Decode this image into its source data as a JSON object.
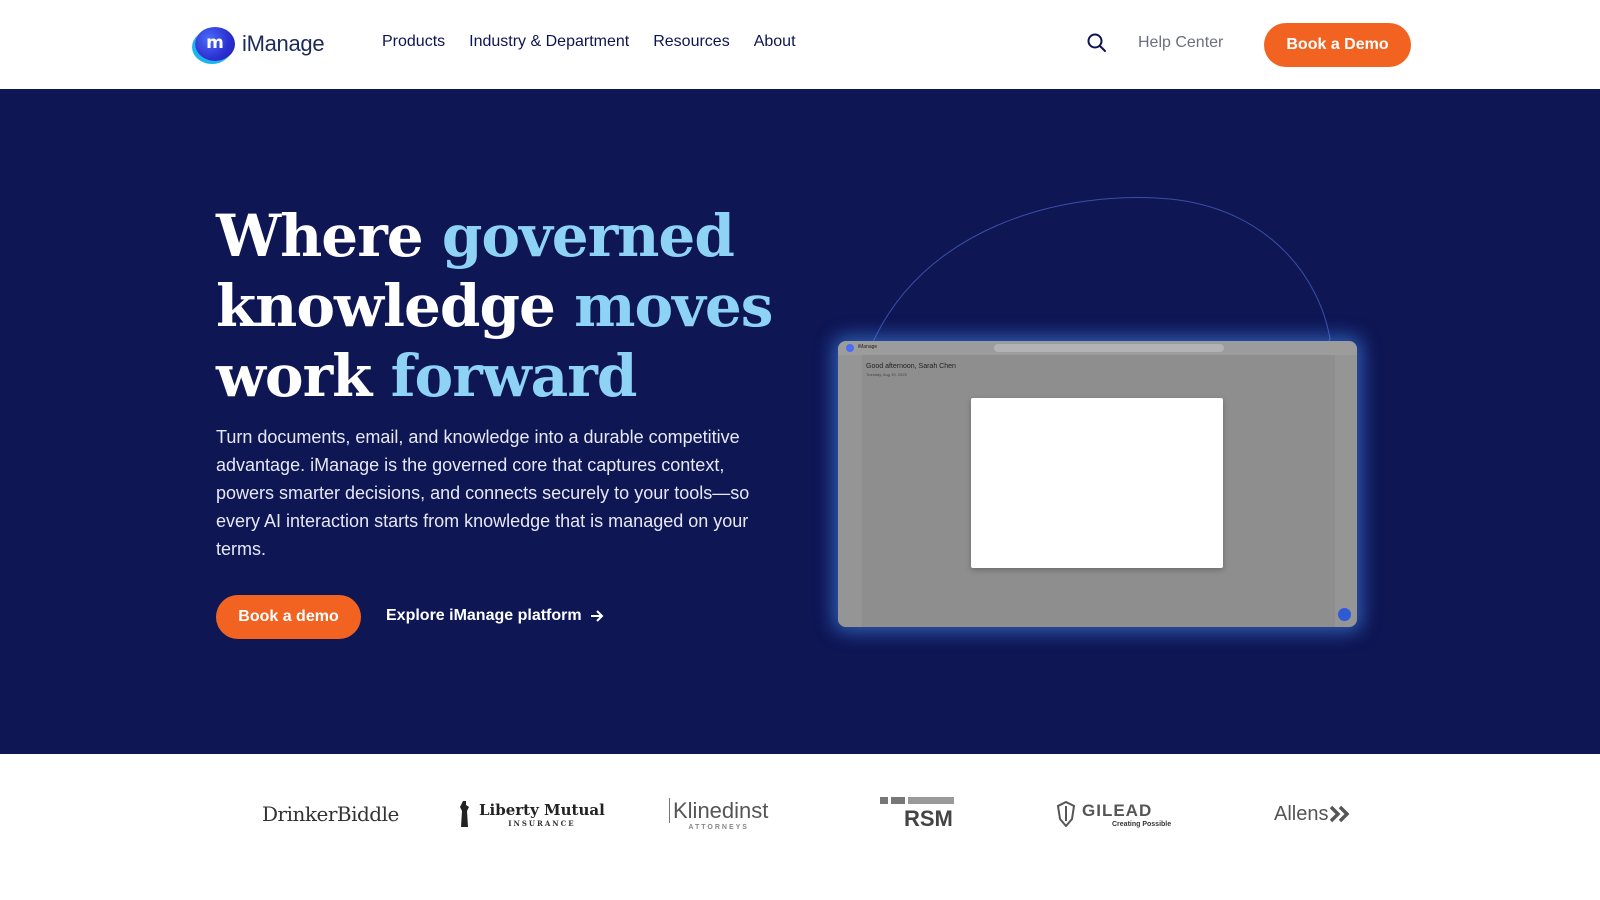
{
  "brand": {
    "logo_mark": "m",
    "name": "iManage"
  },
  "nav": {
    "items": [
      "Products",
      "Industry & Department",
      "Resources",
      "About"
    ],
    "search_icon": "search-icon",
    "help_center": "Help Center",
    "book_demo": "Book a Demo"
  },
  "hero": {
    "headline": {
      "part1": "Where ",
      "accent1": "governed",
      "part2": "knowledge ",
      "accent2": "moves",
      "part3": "work ",
      "accent3": "forward"
    },
    "lead": "Turn documents, email, and knowledge into a durable competitive advantage. iManage is the governed core that captures context, powers smarter decisions, and connects securely to your tools—so every AI interaction starts from knowledge that is managed on your terms.",
    "primary_button": "Book a demo",
    "secondary_link": "Explore iManage platform",
    "secondary_icon": "arrow-right-icon",
    "screenshot": {
      "app_name": "iManage",
      "greeting": "Good afternoon, Sarah Chen",
      "date": "Tuesday, Aug 19, 2025"
    }
  },
  "clients": {
    "drinker": "DrinkerBiddle",
    "liberty": "Liberty Mutual",
    "liberty_sub": "INSURANCE",
    "klinedinst": "Klinedinst",
    "klinedinst_sub": "ATTORNEYS",
    "rsm": "RSM",
    "gilead": "GILEAD",
    "gilead_sub": "Creating Possible",
    "allens": "Allens"
  },
  "colors": {
    "navy": "#0e1654",
    "accent_blue": "#8ed3f5",
    "orange": "#f26322"
  }
}
